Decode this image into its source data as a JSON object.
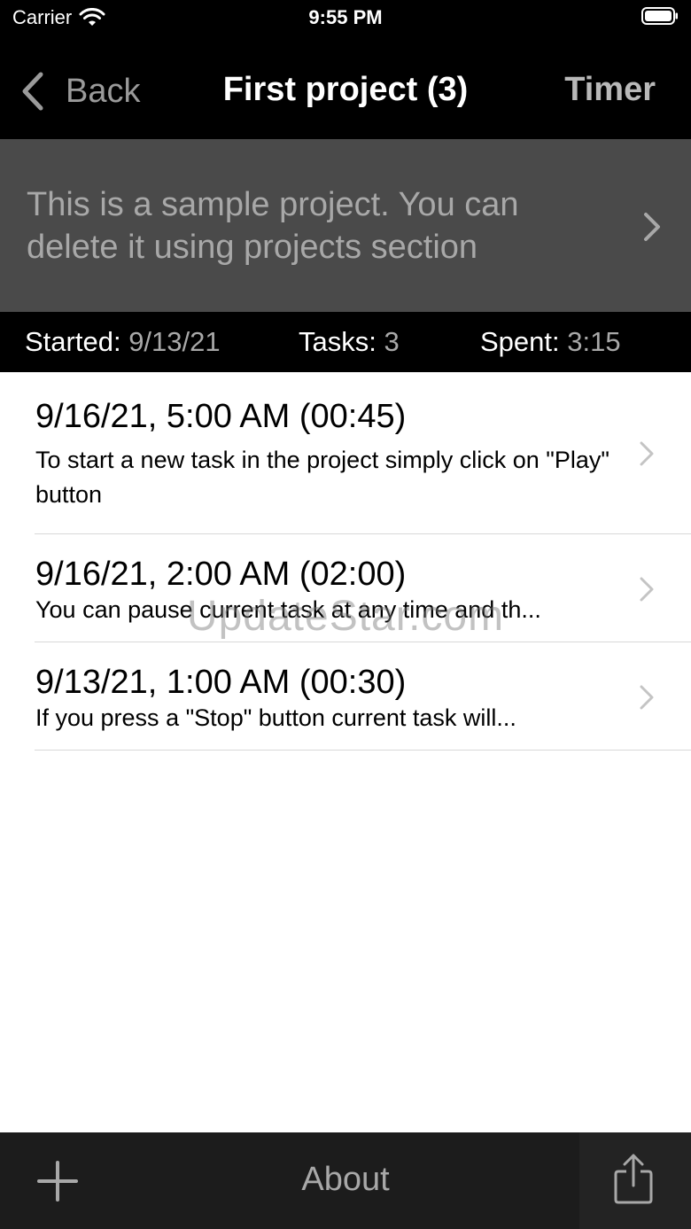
{
  "status_bar": {
    "carrier": "Carrier",
    "time": "9:55 PM"
  },
  "nav": {
    "back_label": "Back",
    "title": "First project (3)",
    "timer_label": "Timer"
  },
  "description": {
    "text": "This is a sample project. You can delete it using projects section"
  },
  "stats": {
    "started_label": "Started:",
    "started_value": "9/13/21",
    "tasks_label": "Tasks:",
    "tasks_value": "3",
    "spent_label": "Spent:",
    "spent_value": "3:15"
  },
  "tasks": [
    {
      "title": "9/16/21, 5:00 AM (00:45)",
      "description": "To start a new task in the project simply click on \"Play\" button"
    },
    {
      "title": "9/16/21, 2:00 AM (02:00)",
      "description": "You can pause current task at any time and th..."
    },
    {
      "title": "9/13/21, 1:00 AM (00:30)",
      "description": "If you press a \"Stop\" button current task will..."
    }
  ],
  "watermark": "UpdateStar.com",
  "toolbar": {
    "about_label": "About"
  },
  "colors": {
    "nav_background": "#000000",
    "banner_background": "#4a4a4a",
    "toolbar_background": "#1c1c1c",
    "muted_text": "#a8a8a8"
  }
}
